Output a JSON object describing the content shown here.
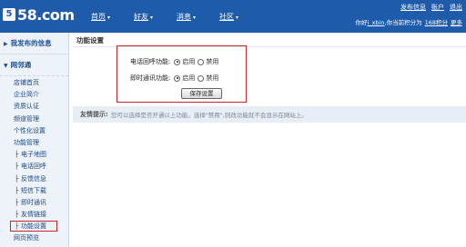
{
  "header": {
    "logo_mark": "5",
    "logo_text": "58.com",
    "nav": [
      {
        "label": "首页"
      },
      {
        "label": "好友"
      },
      {
        "label": "消息"
      },
      {
        "label": "社区"
      }
    ],
    "top_links": [
      "发布信息",
      "账户",
      "退出"
    ],
    "user_greeting": "你好",
    "username": "i_xbin",
    "points_text": ",你当前积分为",
    "points_value": "168积分",
    "more": "更多"
  },
  "sidebar": {
    "section1": "我发布的信息",
    "section2": "网邻通",
    "links": [
      "店铺首页",
      "企业简介",
      "资质认证",
      "频道管理",
      "个性化设置",
      "功能管理"
    ],
    "sub_links": [
      "电子地图",
      "电话回呼",
      "反馈信息",
      "短信下载",
      "即时通讯",
      "友情链接",
      "功能设置"
    ],
    "after_links": [
      "网页预览"
    ],
    "selected": "功能设置"
  },
  "main": {
    "title": "功能设置",
    "settings": [
      {
        "label": "电话回呼功能:",
        "options": [
          "启用",
          "禁用"
        ],
        "selected": "启用"
      },
      {
        "label": "即时通讯功能:",
        "options": [
          "启用",
          "禁用"
        ],
        "selected": "启用"
      }
    ],
    "save_label": "保存设置",
    "tip_label": "友情提示:",
    "tip_text": "您可以选择是否开通以上功能。选择\"禁用\",则改功能就不会显示在网站上。"
  },
  "colors": {
    "header_bg": "#1e5cab",
    "highlight_border": "#c4262e",
    "sidebar_bg": "#eef3fa"
  }
}
